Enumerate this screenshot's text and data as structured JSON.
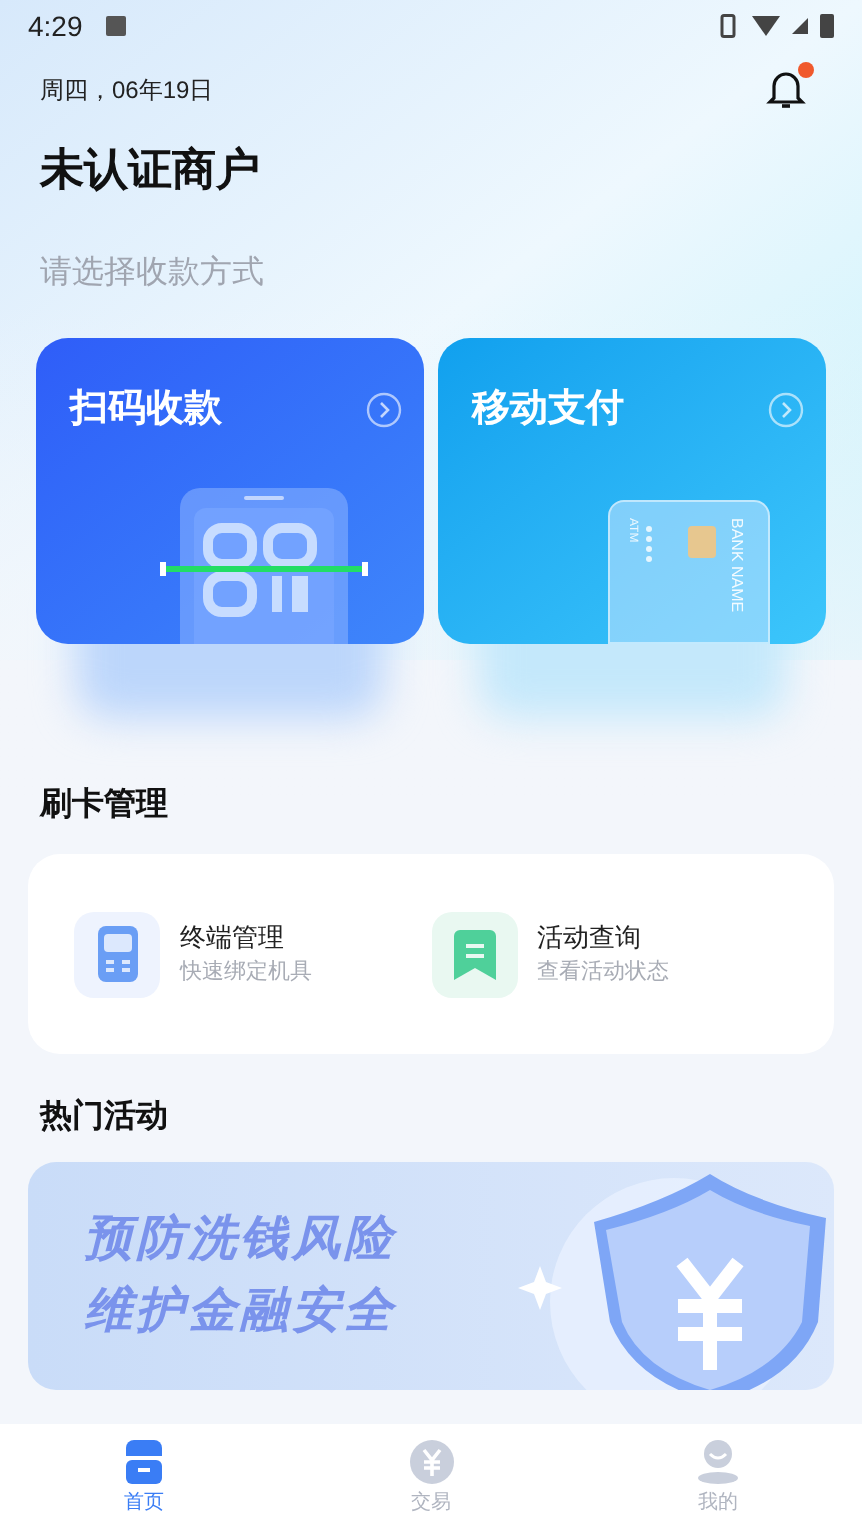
{
  "status_bar": {
    "time": "4:29"
  },
  "header": {
    "date": "周四，06年19日",
    "notification_dot": true,
    "title": "未认证商户",
    "subtitle": "请选择收款方式"
  },
  "pay_cards": [
    {
      "kind": "scan",
      "title": "扫码收款"
    },
    {
      "kind": "card",
      "title": "移动支付",
      "card_texts": [
        "ATM",
        "BANK NAME"
      ]
    }
  ],
  "card_management": {
    "title": "刷卡管理",
    "items": [
      {
        "kind": "terminal",
        "title": "终端管理",
        "subtitle": "快速绑定机具"
      },
      {
        "kind": "activity",
        "title": "活动查询",
        "subtitle": "查看活动状态"
      }
    ]
  },
  "hot_activities": {
    "title": "热门活动",
    "banner_lines": [
      "预防洗钱风险",
      "维护金融安全"
    ]
  },
  "tab_bar": [
    {
      "kind": "home",
      "label": "首页",
      "selected": true
    },
    {
      "kind": "trade",
      "label": "交易",
      "selected": false
    },
    {
      "kind": "mine",
      "label": "我的",
      "selected": false
    }
  ]
}
